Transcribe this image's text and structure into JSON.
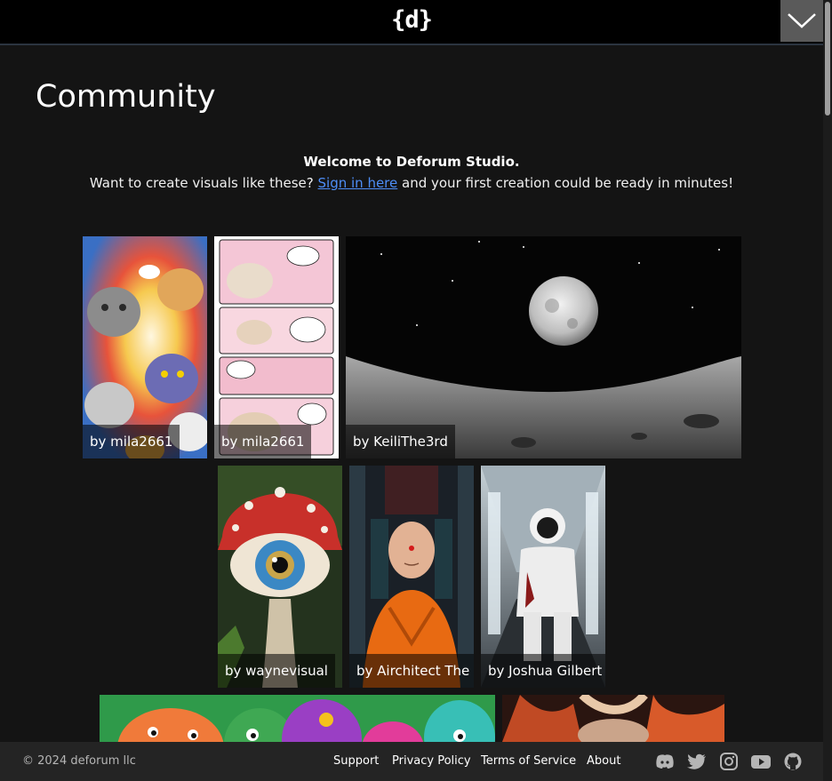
{
  "header": {
    "logo_text": "{d}",
    "menu_icon": "chevron-down-icon"
  },
  "page": {
    "title": "Community"
  },
  "welcome": {
    "title": "Welcome to Deforum Studio.",
    "text_before": "Want to create visuals like these? ",
    "link": "Sign in here",
    "text_after": " and your first creation could be ready in minutes!"
  },
  "gallery": [
    {
      "author": "by mila2661",
      "subject": "colorful cartoon cats collage"
    },
    {
      "author": "by mila2661",
      "subject": "cat comic strip with speech bubbles"
    },
    {
      "author": "by KeiliThe3rd",
      "subject": "full moon over lunar surface"
    },
    {
      "author": "by waynevisual",
      "subject": "mushroom with an eye"
    },
    {
      "author": "by Airchitect The",
      "subject": "meditating monk"
    },
    {
      "author": "by Joshua Gilbert",
      "subject": "astronaut in corridor"
    },
    {
      "author": "",
      "subject": "colorful blob creatures"
    },
    {
      "author": "",
      "subject": "horned creature with fire"
    }
  ],
  "footer": {
    "copyright": "© 2024 deforum llc",
    "links": [
      "Support",
      "Privacy Policy",
      "Terms of Service",
      "About"
    ],
    "social_icons": [
      "discord-icon",
      "twitter-icon",
      "instagram-icon",
      "youtube-icon",
      "github-icon"
    ]
  },
  "colors": {
    "link": "#4e8ef7",
    "background": "#141414",
    "header": "#000000",
    "footer": "#242424"
  }
}
